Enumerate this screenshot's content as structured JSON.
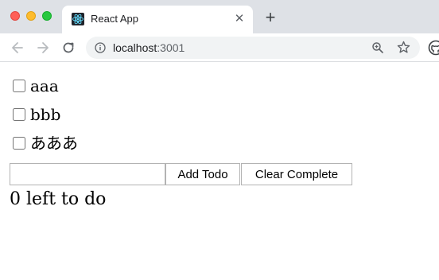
{
  "browser": {
    "tab": {
      "title": "React App",
      "close_glyph": "✕"
    },
    "new_tab_glyph": "+",
    "url_host": "localhost",
    "url_port": ":3001"
  },
  "todos": [
    {
      "label": "aaa",
      "checked": false
    },
    {
      "label": "bbb",
      "checked": false
    },
    {
      "label": "あああ",
      "checked": false
    }
  ],
  "form": {
    "input_value": "",
    "add_label": "Add Todo",
    "clear_label": "Clear Complete"
  },
  "left_text": "0 left to do",
  "colors": {
    "tab_bar_bg": "#dee1e6",
    "react_logo": "#61dafb",
    "traffic_red": "#fe5f57",
    "traffic_yellow": "#febc2e",
    "traffic_green": "#28c840"
  },
  "icons": [
    "back-arrow-icon",
    "forward-arrow-icon",
    "reload-icon",
    "info-icon",
    "zoom-icon",
    "star-icon",
    "github-icon",
    "react-logo-icon"
  ]
}
